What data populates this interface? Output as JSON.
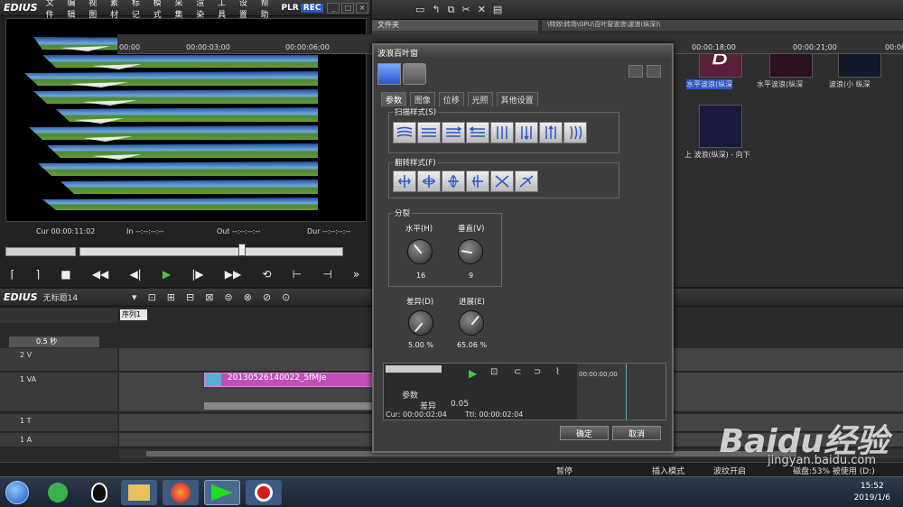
{
  "app": {
    "logo": "EDIUS",
    "menu": [
      "文件",
      "编辑",
      "视图",
      "素材",
      "标记",
      "模式",
      "采集",
      "渲染",
      "工具",
      "设置",
      "帮助"
    ],
    "plr": "PLR",
    "rec": "REC"
  },
  "player": {
    "cur": "Cur 00:00:11:02",
    "in": "In --:--:--:--",
    "out": "Out --:--:--:--",
    "dur": "Dur --:--:--:--"
  },
  "bin": {
    "folders_label": "文件夹",
    "expand_label": "扩展",
    "path": "\\特效\\转场\\GPU\\百叶窗波浪\\波浪(纵深)\\",
    "items": [
      {
        "label": "水平波浪(纵深"
      },
      {
        "label": "水平波浪(纵深"
      },
      {
        "label": "波浪(小 纵深"
      },
      {
        "label": "上 波浪(纵深) - 向下"
      }
    ]
  },
  "dialog": {
    "title": "波浪百叶窗",
    "tabs": [
      "参数",
      "图像",
      "位移",
      "光照",
      "其他设置"
    ],
    "scan_group": "扫描样式(S)",
    "flip_group": "翻转样式(F)",
    "split_group": "分裂",
    "horizontal_label": "水平(H)",
    "vertical_label": "垂直(V)",
    "horizontal_value": "16",
    "vertical_value": "9",
    "diff_label": "差异(D)",
    "progress_label": "进展(E)",
    "diff_value": "5.00 %",
    "progress_value": "65.06 %",
    "kf_param": "参数",
    "kf_diff": "差异",
    "kf_diff_value": "0.05",
    "kf_cur": "Cur: 00:00:02:04",
    "kf_ttl": "Ttl: 00:00:02:04",
    "kf_time": "00:00:00;00",
    "ok": "确定",
    "cancel": "取消"
  },
  "timeline": {
    "logo": "EDIUS",
    "project": "无标题14",
    "sequence_tab": "序列1",
    "zoom": "0.5 秒",
    "ruler": [
      "00:00",
      "00:00:03;00",
      "00:00:06;00",
      "00:00:18;00",
      "00:00:21;00",
      "00:00:"
    ],
    "tracks": [
      "2 V",
      "1 VA",
      "1 T",
      "1 A"
    ],
    "clip_name": "20130526140022_5fMJe"
  },
  "status": {
    "pause": "暂停",
    "insert": "插入模式",
    "ripple": "波纹开启",
    "disk": "磁盘:53% 被使用 (D:)"
  },
  "taskbar": {
    "time": "15:52",
    "date": "2019/1/6"
  },
  "watermark": {
    "text": "Baidu经验",
    "url": "jingyan.baidu.com"
  }
}
